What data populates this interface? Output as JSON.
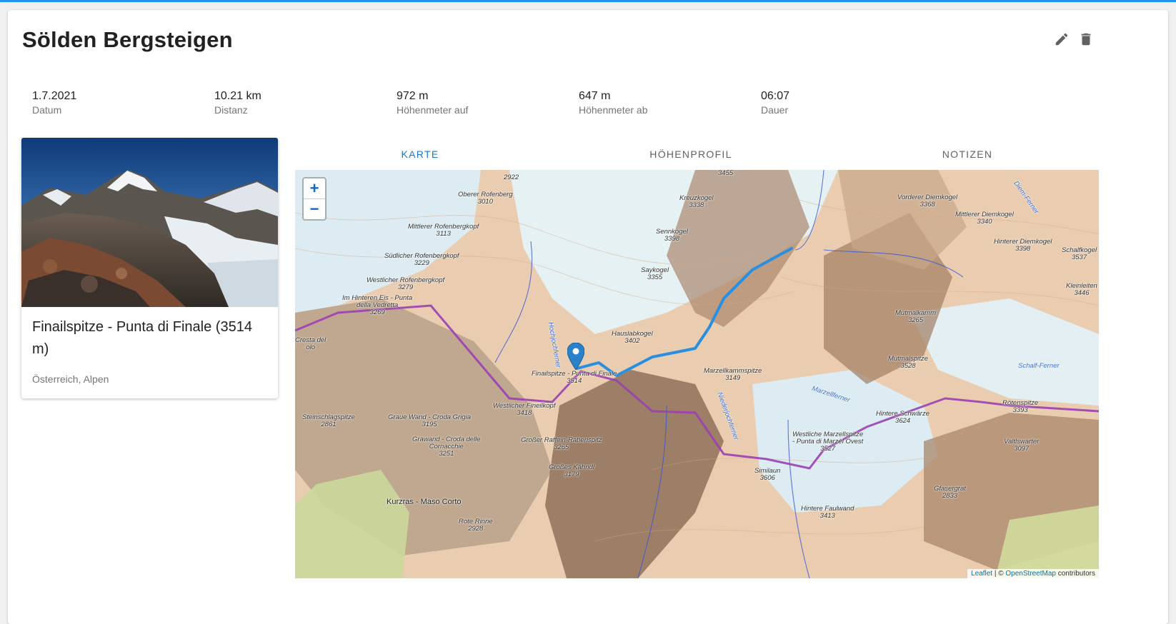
{
  "tour": {
    "title": "Sölden Bergsteigen",
    "edit_icon": "pencil-icon",
    "delete_icon": "trash-icon"
  },
  "stats": [
    {
      "value": "1.7.2021",
      "label": "Datum"
    },
    {
      "value": "10.21 km",
      "label": "Distanz"
    },
    {
      "value": "972 m",
      "label": "Höhenmeter auf"
    },
    {
      "value": "647 m",
      "label": "Höhenmeter ab"
    },
    {
      "value": "06:07",
      "label": "Dauer"
    }
  ],
  "summit": {
    "name": "Finailspitze - Punta di Finale (3514 m)",
    "region": "Österreich, Alpen"
  },
  "tabs": [
    {
      "label": "KARTE",
      "active": true
    },
    {
      "label": "HÖHENPROFIL",
      "active": false
    },
    {
      "label": "NOTIZEN",
      "active": false
    }
  ],
  "map": {
    "zoom_in": "+",
    "zoom_out": "−",
    "attribution_leaflet": "Leaflet",
    "attribution_sep": " | © ",
    "attribution_osm": "OpenStreetMap",
    "attribution_suffix": " contributors",
    "route_color": "#2b8fe0",
    "border_color": "#9b3fb5",
    "labels": [
      {
        "name": "2922"
      },
      {
        "name": "Oberer Rofenberg\n3010"
      },
      {
        "name": "Mittlerer Rofenbergkopf\n3113"
      },
      {
        "name": "Südlicher Rofenbergkopf\n3229"
      },
      {
        "name": "Westlicher Rofenbergkopf\n3279"
      },
      {
        "name": "Im Hinteren Eis - Punta\ndella Vedretta\n3269"
      },
      {
        "name": "Cresta del\nolo"
      },
      {
        "name": "3455"
      },
      {
        "name": "Kreuzkogel\n3338"
      },
      {
        "name": "Sennkogel\n3398"
      },
      {
        "name": "Saykogel\n3355"
      },
      {
        "name": "Hauslabkogel\n3402"
      },
      {
        "name": "Finailspitze - Punta di Finale\n3514"
      },
      {
        "name": "Westlicher Fineilkopf\n3418"
      },
      {
        "name": "Steinschlagspitze\n2861"
      },
      {
        "name": "Graue Wand - Croda Grigia\n3195"
      },
      {
        "name": "Grawand - Croda delle\nCornacchie\n3251"
      },
      {
        "name": "Großer Raffein-Rabenspitz\n3265"
      },
      {
        "name": "Großes Kahndl\n3179"
      },
      {
        "name": "Kurzras - Maso Corto"
      },
      {
        "name": "Rote Rinne\n2928"
      },
      {
        "name": "Marzellkammspitze\n3149"
      },
      {
        "name": "Mutmalkamm\n3265"
      },
      {
        "name": "Mutmalspitze\n3528"
      },
      {
        "name": "Westliche Marzellspitze\n- Punta di Marzèl Ovest\n3527"
      },
      {
        "name": "Similaun\n3606"
      },
      {
        "name": "Hintere Schwärze\n3624"
      },
      {
        "name": "Hintere Faulwand\n3413"
      },
      {
        "name": "Vorderer Diemkogel\n3368"
      },
      {
        "name": "Mittlerer Diemkogel\n3340"
      },
      {
        "name": "Hinterer Diemkogel\n3398"
      },
      {
        "name": "Schalfkogel\n3537"
      },
      {
        "name": "Kleinleiten\n3446"
      },
      {
        "name": "Rötenspitze\n3393"
      },
      {
        "name": "Valtlswarter\n3097"
      },
      {
        "name": "Gfasergrat\n2833"
      },
      {
        "name": "Schalf-Ferner"
      },
      {
        "name": "Marzellferner"
      },
      {
        "name": "Diem-Ferner"
      },
      {
        "name": "Niederjochferner"
      },
      {
        "name": "Hochjochferner"
      }
    ]
  }
}
